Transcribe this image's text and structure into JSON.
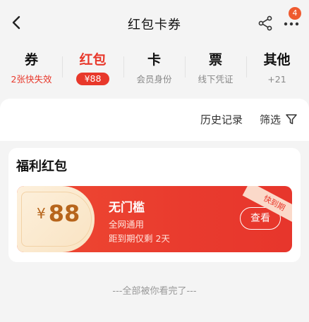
{
  "header": {
    "title": "红包卡券",
    "badge_count": "4",
    "icons": {
      "back": "chevron-left-icon",
      "share": "share-icon",
      "more": "more-dots-icon"
    }
  },
  "tabs": [
    {
      "label": "券",
      "sub": "2张快失效"
    },
    {
      "label": "红包",
      "sub": "¥88"
    },
    {
      "label": "卡",
      "sub": "会员身份"
    },
    {
      "label": "票",
      "sub": "线下凭证"
    },
    {
      "label": "其他",
      "sub": "+21"
    }
  ],
  "toolbar": {
    "history": "历史记录",
    "filter": "筛选"
  },
  "section": {
    "title": "福利红包"
  },
  "coupon": {
    "currency": "¥",
    "amount": "88",
    "title": "无门槛",
    "scope": "全网通用",
    "expiry": "距到期仅剩 2天",
    "button": "查看",
    "ribbon": "快到期"
  },
  "footer": "---全部被你看完了---",
  "colors": {
    "accent": "#e8382b",
    "gold": "#b7651c",
    "background": "#f4f4f4"
  }
}
